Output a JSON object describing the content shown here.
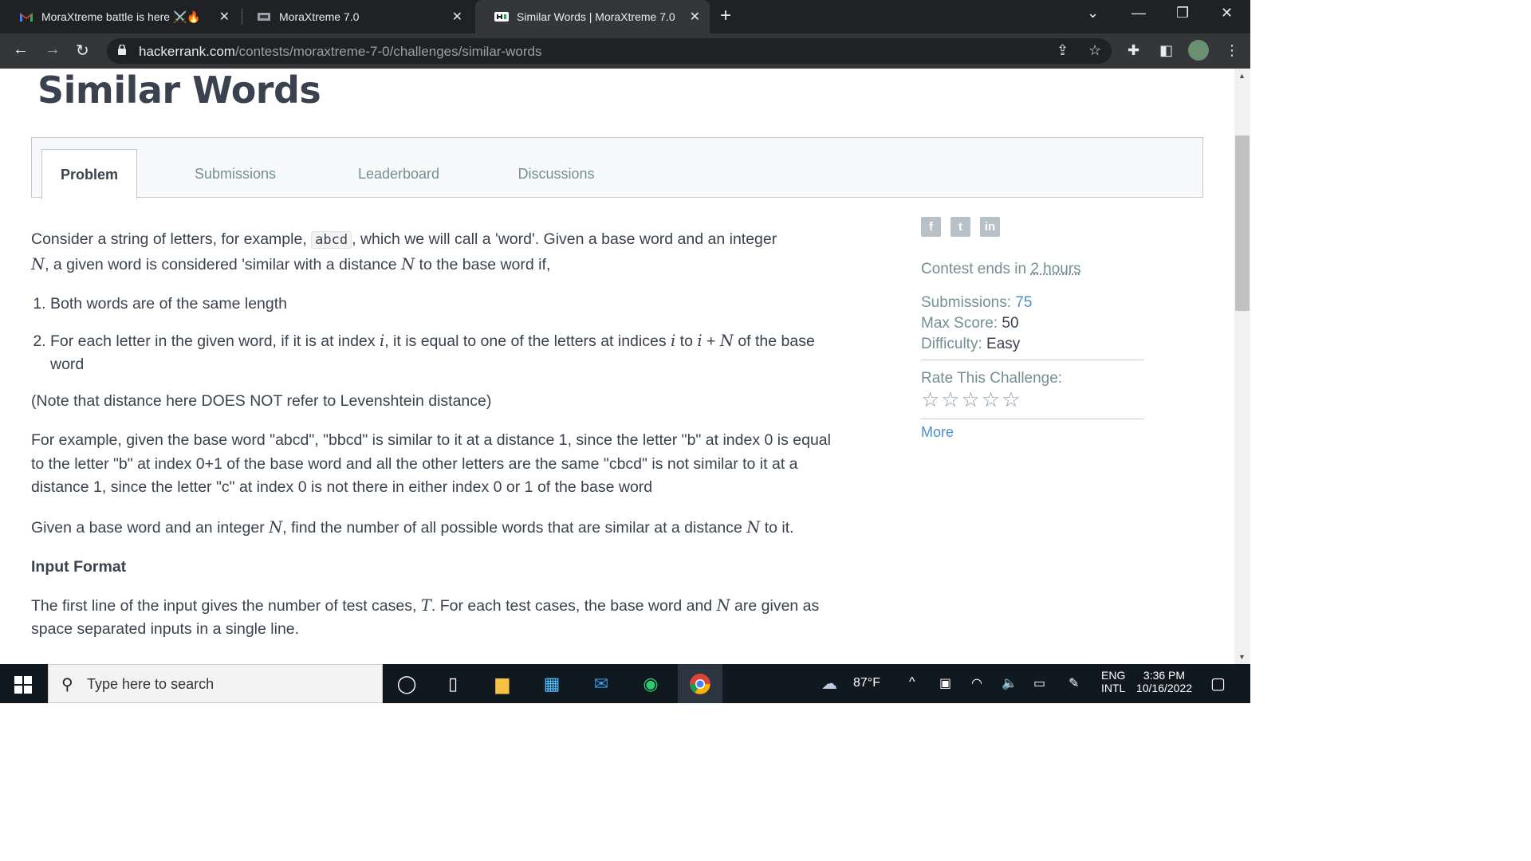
{
  "browser": {
    "tabs": [
      {
        "title": "MoraXtreme battle is here ⚔️🔥",
        "favicon": "gmail-icon"
      },
      {
        "title": "MoraXtreme 7.0",
        "favicon": "mora-icon"
      },
      {
        "title": "Similar Words | MoraXtreme 7.0",
        "favicon": "hackerrank-icon"
      }
    ],
    "url_domain": "hackerrank.com",
    "url_path": "/contests/moraxtreme-7-0/challenges/similar-words"
  },
  "page": {
    "title": "Similar Words",
    "tabs": [
      "Problem",
      "Submissions",
      "Leaderboard",
      "Discussions"
    ],
    "intro_pre": "Consider a string of letters, for example, ",
    "intro_code": "abcd",
    "intro_post": ", which we will call a 'word'. Given a base word and an integer",
    "intro_line2_a": ", a given word is considered 'similar with a distance ",
    "intro_line2_b": " to the base word if,",
    "var_N": "N",
    "var_i": "i",
    "var_T": "T",
    "list1": "Both words are of the same length",
    "list2_a": "For each letter in the given word, if it is at index ",
    "list2_b": ", it is equal to one of the letters at indices ",
    "list2_c": " to ",
    "list2_plus": " + ",
    "list2_d": " of the base word",
    "note": "(Note that distance here DOES NOT refer to Levenshtein distance)",
    "example": "For example, given the base word \"abcd\", \"bbcd\" is similar to it at a distance 1, since the letter \"b\" at index 0 is equal to the letter \"b\" at index 0+1 of the base word and all the other letters are the same \"cbcd\" is not similar to it at a distance 1, since the letter \"c\" at index 0 is not there in either index 0 or 1 of the base word",
    "task_a": "Given a base word and an integer ",
    "task_b": ", find the number of all possible words that are similar at a distance ",
    "task_c": " to it.",
    "input_heading": "Input Format",
    "input_a": "The first line of the input gives the number of test cases, ",
    "input_b": ". For each test cases, the base word and ",
    "input_c": " are given as space separated inputs in a single line."
  },
  "sidebar": {
    "contest_ends_label": "Contest ends in ",
    "contest_ends_value": "2 hours",
    "submissions_label": "Submissions:",
    "submissions_value": "75",
    "max_score_label": "Max Score:",
    "max_score_value": "50",
    "difficulty_label": "Difficulty:",
    "difficulty_value": "Easy",
    "rate_label": "Rate This Challenge:",
    "stars": "☆☆☆☆☆",
    "more": "More"
  },
  "taskbar": {
    "search_placeholder": "Type here to search",
    "weather": "87°F",
    "lang1": "ENG",
    "lang2": "INTL",
    "time": "3:36 PM",
    "date": "10/16/2022"
  },
  "colors": {
    "link_blue": "#4a8fd5",
    "text_dark": "#39424e",
    "muted": "#738f93"
  }
}
